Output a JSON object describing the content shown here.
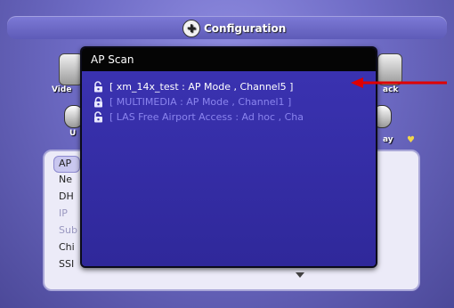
{
  "header": {
    "title": "Configuration"
  },
  "background": {
    "tile_left_label": "Vide",
    "tile_right_label": "ack",
    "left_small_label": "U",
    "right_small_label": "ay",
    "panel_rows": [
      "AP",
      "Ne",
      "DH",
      "IP",
      "Sub",
      "Chi",
      "SSI"
    ]
  },
  "dialog": {
    "title": "AP Scan",
    "items": [
      {
        "text": "[ xm_14x_test : AP Mode  , Channel5 ]",
        "locked": false
      },
      {
        "text": "[ MULTIMEDIA  : AP Mode  , Channel1 ]",
        "locked": true
      },
      {
        "text": "[ LAS Free Airport Access : Ad hoc  , Cha",
        "locked": false
      }
    ]
  },
  "colors": {
    "dialog_bg": "#3a32a6",
    "title_bg": "#050505",
    "arrow": "#e00000"
  }
}
